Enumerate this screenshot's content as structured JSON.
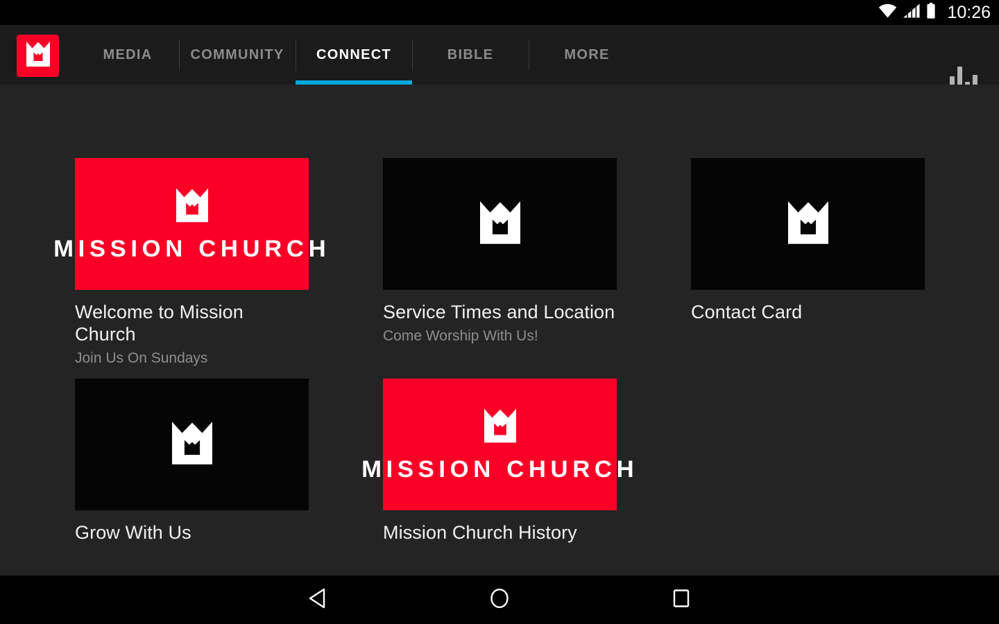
{
  "status_bar": {
    "clock": "10:26",
    "icons": [
      "wifi-icon",
      "cellular-signal-icon",
      "battery-icon"
    ]
  },
  "app_bar": {
    "brand": {
      "icon": "mission-church-logo-icon",
      "color": "#fa0027"
    },
    "active_tab": "CONNECT",
    "accent_color": "#03a9dc",
    "tabs": [
      {
        "label": "MEDIA",
        "active": false
      },
      {
        "label": "COMMUNITY",
        "active": false
      },
      {
        "label": "CONNECT",
        "active": true
      },
      {
        "label": "BIBLE",
        "active": false
      },
      {
        "label": "MORE",
        "active": false
      }
    ],
    "action": {
      "icon": "bar-chart-icon",
      "label": "Stats"
    }
  },
  "content": {
    "cards": [
      {
        "title": "Welcome to Mission Church",
        "subtitle": "Join Us On Sundays",
        "thumb_style": "red",
        "wordmark": "MISSION CHURCH",
        "icon": "mission-church-logo-icon"
      },
      {
        "title": "Service Times and Location",
        "subtitle": "Come Worship With Us!",
        "thumb_style": "black",
        "wordmark": "",
        "icon": "mission-church-logo-icon"
      },
      {
        "title": "Contact Card",
        "subtitle": "",
        "thumb_style": "black",
        "wordmark": "",
        "icon": "mission-church-logo-icon"
      },
      {
        "title": "Grow With Us",
        "subtitle": "",
        "thumb_style": "black",
        "wordmark": "",
        "icon": "mission-church-logo-icon"
      },
      {
        "title": "Mission Church History",
        "subtitle": "",
        "thumb_style": "red",
        "wordmark": "MISSION CHURCH",
        "icon": "mission-church-logo-icon"
      }
    ]
  },
  "nav_bar": {
    "buttons": [
      {
        "name": "back-button",
        "icon": "back-triangle-icon"
      },
      {
        "name": "home-button",
        "icon": "home-circle-icon"
      },
      {
        "name": "recents-button",
        "icon": "recents-square-icon"
      }
    ]
  },
  "colors": {
    "brand_red": "#fa0027",
    "accent_cyan": "#03a9dc",
    "page_bg": "#242424",
    "app_bar_bg": "#1b1b1b"
  }
}
